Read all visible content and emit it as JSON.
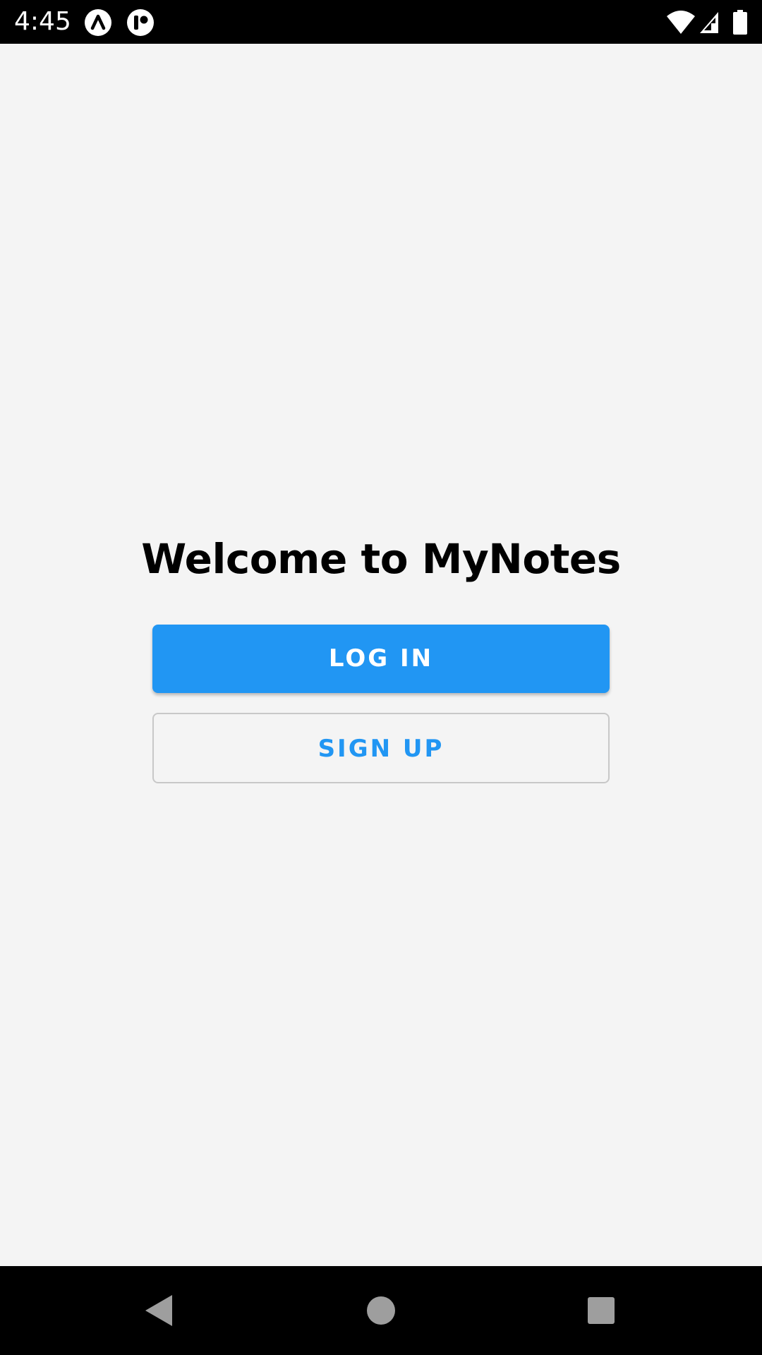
{
  "status_bar": {
    "time": "4:45",
    "notification_icons": [
      "app-a-icon",
      "app-record-icon"
    ],
    "system_icons": [
      "wifi-icon",
      "signal-icon",
      "battery-icon"
    ]
  },
  "main": {
    "title": "Welcome to MyNotes",
    "login_label": "LOG IN",
    "signup_label": "SIGN UP"
  },
  "colors": {
    "accent": "#2196f3",
    "background": "#f4f4f4",
    "status_bar": "#000000",
    "outline_border": "#c8c8c8"
  },
  "nav_bar": {
    "buttons": [
      "back-icon",
      "home-icon",
      "recents-icon"
    ]
  }
}
